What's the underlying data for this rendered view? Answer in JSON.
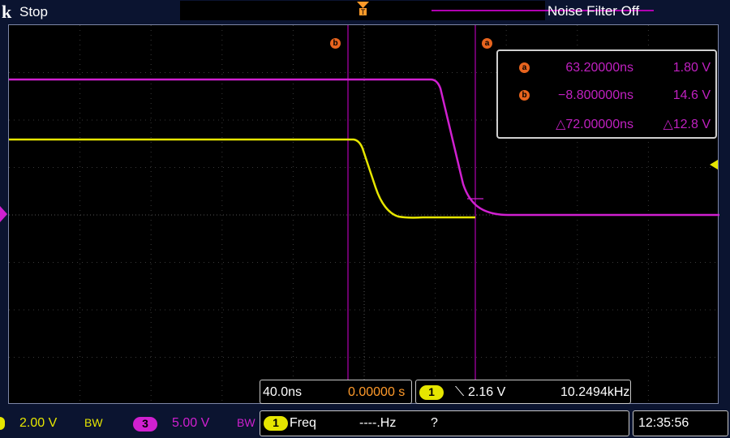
{
  "header": {
    "brand": "k",
    "acq_state": "Stop",
    "noise_filter": "Noise Filter Off",
    "trigger_marker": "T"
  },
  "screen": {
    "cursor_a_label": "a",
    "cursor_b_label": "b",
    "channel_marker_icon": "channel-ground-icon"
  },
  "readout": {
    "a": {
      "marker": "a",
      "time": "63.20000ns",
      "voltage": "1.80 V"
    },
    "b": {
      "marker": "b",
      "time": "−8.800000ns",
      "voltage": "14.6 V"
    },
    "delta": {
      "time": "△72.00000ns",
      "voltage": "△12.8 V"
    }
  },
  "bottom": {
    "timebase": "40.0ns",
    "delay": "0.00000 s",
    "trig_channel": "1",
    "trig_slope": "⟍",
    "trig_level": "2.16 V",
    "trig_freq": "10.2494kHz",
    "ch1_scale": "2.00 V",
    "ch1_bw": "BW",
    "ch3_number": "3",
    "ch3_scale": "5.00 V",
    "ch3_bw": "BW",
    "meas_channel": "1",
    "meas_name": "Freq",
    "meas_value": "----.Hz",
    "meas_status": "?",
    "clock": "12:35:56"
  },
  "colors": {
    "ch1": "#e6e600",
    "ch3": "#d020d0",
    "cursor": "#e8641e",
    "bg": "#0b1430"
  }
}
